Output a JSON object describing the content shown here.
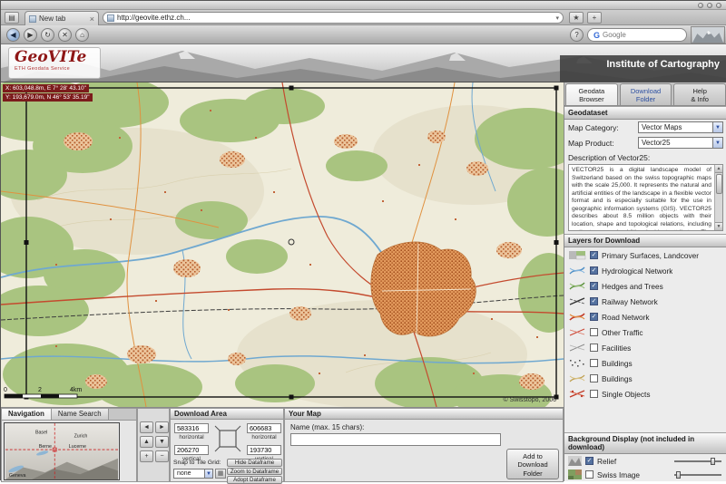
{
  "browser": {
    "tab_label": "New tab",
    "tab_close_icon": "×",
    "url_value": "http://geovite.ethz.ch...",
    "search_placeholder": "Google",
    "search_logo": "G",
    "icons": {
      "back": "◀",
      "forward": "▶",
      "reload": "↻",
      "stop": "✕",
      "home": "⌂",
      "help": "?",
      "url_dropdown": "▾",
      "bookmark": "★",
      "add": "+",
      "sidebar": "▤"
    }
  },
  "header": {
    "logo_text": "GeoVITe",
    "logo_subtitle": "ETH Geodata Service",
    "institute": "Institute of Cartography"
  },
  "map": {
    "coord_line1": "X: 603,048.8m, E 7° 28' 43.10\"",
    "coord_line2": "Y: 193,679.0m, N 46° 53' 35.19\"",
    "scale": {
      "s0": "0",
      "s1": "2",
      "s2": "4km"
    },
    "copyright": "© Swisstopo, 2006"
  },
  "sidebar": {
    "tabs": [
      {
        "line1": "Geodata",
        "line2": "Browser"
      },
      {
        "line1": "Download",
        "line2": "Folder"
      },
      {
        "line1": "Help",
        "line2": "& Info"
      }
    ],
    "geodataset": {
      "title": "Geodataset",
      "map_category_label": "Map Category:",
      "map_category_value": "Vector Maps",
      "map_product_label": "Map Product:",
      "map_product_value": "Vector25",
      "description_label": "Description of Vector25:",
      "description": "VECTOR25 is a digital landscape model of Switzerland based on the swiss topographic maps with the scale 25,000. It represents the natural and artificial entities of the landscape in a flexible vector format and is especially suitable for the use in geographic information systems (GIS). VECTOR25 describes about 8.5 million objects with their location, shape and topological relations, including entity types and additional object attributes. The perimeter of the dataset matches the area covered by the topographic maps."
    },
    "layers": {
      "title": "Layers for Download",
      "items": [
        {
          "label": "Primary Surfaces, Landcover",
          "checked": true,
          "icon": "landcover-swatch-icon",
          "c1": "#9aa89a",
          "c2": "#85a85f"
        },
        {
          "label": "Hydrological Network",
          "checked": true,
          "icon": "hydrology-lines-icon",
          "c1": "#4f8fc6",
          "c2": "#7fb2dd"
        },
        {
          "label": "Hedges and Trees",
          "checked": true,
          "icon": "hedges-lines-icon",
          "c1": "#5f9440",
          "c2": "#8cb86a"
        },
        {
          "label": "Railway Network",
          "checked": true,
          "icon": "railway-lines-icon",
          "c1": "#333333",
          "c2": "#666666"
        },
        {
          "label": "Road Network",
          "checked": true,
          "icon": "road-lines-icon",
          "c1": "#c23a26",
          "c2": "#e08a3c"
        },
        {
          "label": "Other Traffic",
          "checked": false,
          "icon": "other-traffic-lines-icon",
          "c1": "#cc4433",
          "c2": "#dd7766"
        },
        {
          "label": "Facilities",
          "checked": false,
          "icon": "facilities-lines-icon",
          "c1": "#8a8a8a",
          "c2": "#b0b0b0"
        },
        {
          "label": "Buildings",
          "checked": false,
          "icon": "buildings-dots-icon",
          "c1": "#555555",
          "c2": "#777777"
        },
        {
          "label": "Buildings",
          "checked": false,
          "icon": "buildings-lines-icon",
          "c1": "#bfa050",
          "c2": "#d8c080"
        },
        {
          "label": "Single Objects",
          "checked": false,
          "icon": "single-objects-icon",
          "c1": "#c23a26",
          "c2": "#d86a50"
        }
      ]
    },
    "background": {
      "title": "Background Display (not included in download)",
      "items": [
        {
          "label": "Relief",
          "checked": true,
          "icon": "relief-thumb-icon",
          "slider_pos": "76%"
        },
        {
          "label": "Swiss Image",
          "checked": false,
          "icon": "swissimage-thumb-icon",
          "slider_pos": "4%"
        }
      ]
    }
  },
  "bottom": {
    "nav_tabs": [
      {
        "label": "Navigation"
      },
      {
        "label": "Name Search"
      }
    ],
    "overview_cities": {
      "basel": "Basel",
      "zurich": "Zurich",
      "lucerne": "Lucerne",
      "berne": "Berne",
      "geneva": "Geneva"
    },
    "controls": {
      "left": "◄",
      "right": "►",
      "up": "▲",
      "down": "▼",
      "zoom_in": "+",
      "zoom_out": "−"
    },
    "download_area": {
      "title": "Download Area",
      "h1": {
        "value": "583316",
        "label": "horizontal"
      },
      "h2": {
        "value": "606683",
        "label": "horizontal"
      },
      "v1": {
        "value": "206270",
        "label": "vertical"
      },
      "v2": {
        "value": "193730",
        "label": "vertical"
      },
      "buttons": {
        "hide": "Hide Dataframe",
        "zoom": "Zoom to Dataframe",
        "adopt": "Adopt Dataframe"
      },
      "snap_label": "Snap to Tile Grid:",
      "snap_value": "none"
    },
    "your_map": {
      "title": "Your Map",
      "name_label": "Name (max. 15 chars):",
      "name_value": ""
    },
    "add_button": "Add to Download Folder"
  },
  "ui": {
    "select_arrow": "▼",
    "grid_button": "▦"
  }
}
